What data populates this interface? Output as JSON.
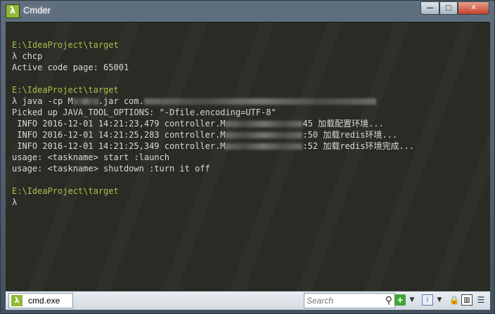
{
  "window": {
    "title": "Cmder",
    "app_icon_glyph": "λ",
    "buttons": {
      "minimize": "—",
      "maximize": "□",
      "close": "✕"
    }
  },
  "console": {
    "lines": [
      "E:\\IdeaProject\\target",
      "λ chcp",
      "Active code page: 65001",
      "",
      "E:\\IdeaProject\\target",
      "λ java -cp M",
      "Picked up JAVA_TOOL_OPTIONS: \"-Dfile.encoding=UTF-8\"",
      " INFO 2016-12-01 14:21:23,479 controller.M",
      " INFO 2016-12-01 14:21:25,283 controller.M",
      " INFO 2016-12-01 14:21:25,349 controller.M",
      "usage: <taskname> start :launch",
      "usage: <taskname> shutdown :turn it off",
      "",
      "E:\\IdeaProject\\target",
      "λ"
    ],
    "java_jar": ".jar com.",
    "info_suffix": [
      "45 加载配置环境...",
      ":50 加载redis环境...",
      ":52 加载redis环境完成..."
    ]
  },
  "statusbar": {
    "tab_label": "cmd.exe",
    "tab_icon_glyph": "λ",
    "search_placeholder": "Search",
    "search_icon": "⚲",
    "plus_icon": "+",
    "dropdown": "▼",
    "panel_icon": "i",
    "lock_icon": "🔒",
    "split_icon": "▥",
    "menu_icon": "☰"
  },
  "colors": {
    "prompt_green": "#a6c24a",
    "console_bg": "#2a2b24",
    "text": "#d8d8d8"
  }
}
